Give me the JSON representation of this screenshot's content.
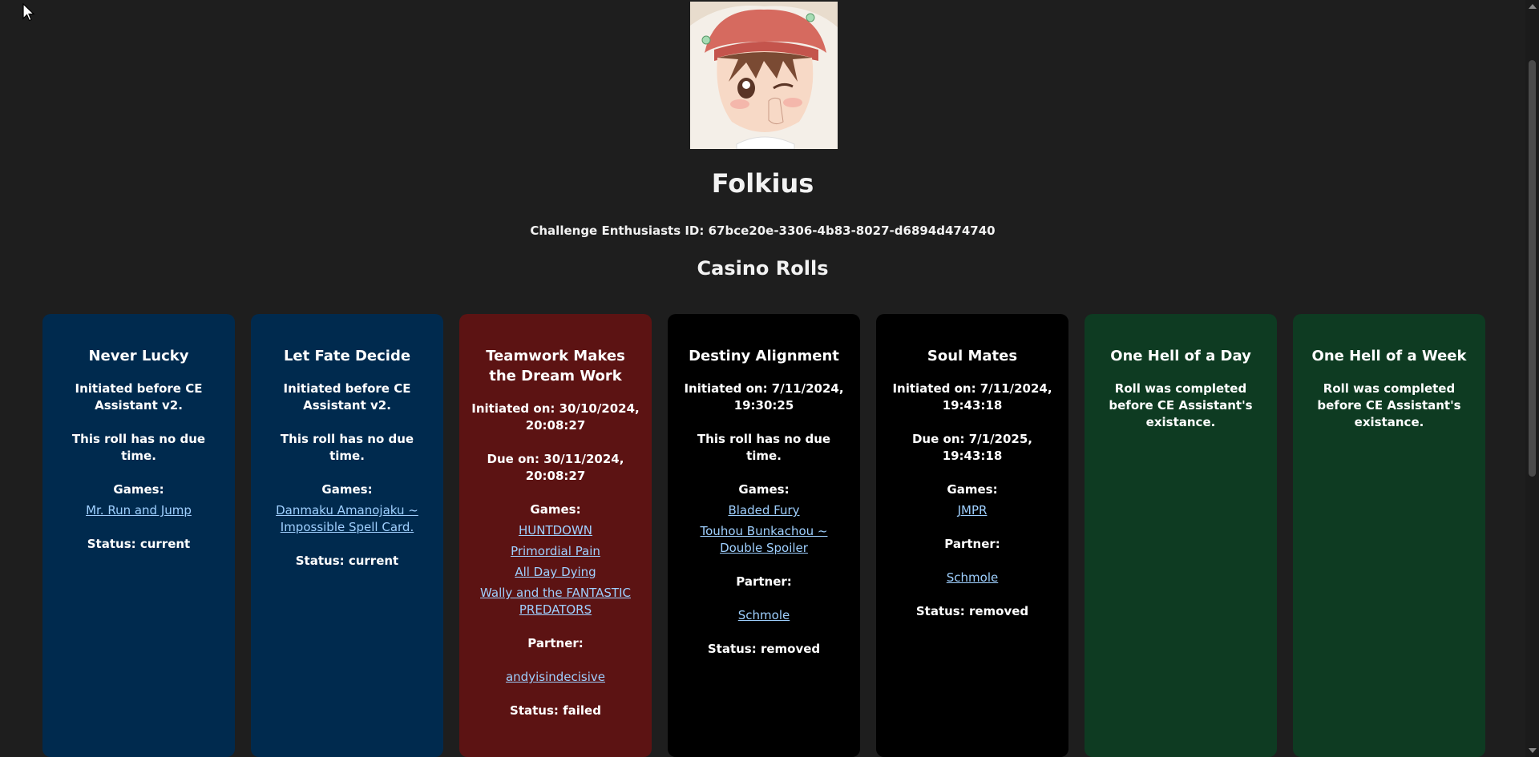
{
  "profile": {
    "username": "Folkius",
    "ce_id": "Challenge Enthusiasts ID: 67bce20e-3306-4b83-8027-d6894d474740"
  },
  "section": {
    "title": "Casino Rolls"
  },
  "labels": {
    "games": "Games:",
    "partner": "Partner:"
  },
  "cards": [
    {
      "title": "Never Lucky",
      "initiated": "Initiated before CE Assistant v2.",
      "due": "This roll has no due time.",
      "games": [
        "Mr. Run and Jump"
      ],
      "status": "Status: current",
      "color": "#002a4e"
    },
    {
      "title": "Let Fate Decide",
      "initiated": "Initiated before CE Assistant v2.",
      "due": "This roll has no due time.",
      "games": [
        "Danmaku Amanojaku ~ Impossible Spell Card."
      ],
      "status": "Status: current",
      "color": "#002a4e"
    },
    {
      "title": "Teamwork Makes the Dream Work",
      "initiated": "Initiated on: 30/10/2024, 20:08:27",
      "due": "Due on: 30/11/2024, 20:08:27",
      "games": [
        "HUNTDOWN",
        "Primordial Pain",
        "All Day Dying",
        "Wally and the FANTASTIC PREDATORS"
      ],
      "partner": "andyisindecisive",
      "status": "Status: failed",
      "color": "#5c1313"
    },
    {
      "title": "Destiny Alignment",
      "initiated": "Initiated on: 7/11/2024, 19:30:25",
      "due": "This roll has no due time.",
      "games": [
        "Bladed Fury",
        "Touhou Bunkachou ~ Double Spoiler"
      ],
      "partner": "Schmole",
      "status": "Status: removed",
      "color": "#000000"
    },
    {
      "title": "Soul Mates",
      "initiated": "Initiated on: 7/11/2024, 19:43:18",
      "due": "Due on: 7/1/2025, 19:43:18",
      "games": [
        "JMPR"
      ],
      "partner": "Schmole",
      "status": "Status: removed",
      "color": "#000000"
    },
    {
      "title": "One Hell of a Day",
      "note": "Roll was completed before CE Assistant's existance.",
      "color": "#0e3b22"
    },
    {
      "title": "One Hell of a Week",
      "note": "Roll was completed before CE Assistant's existance.",
      "color": "#0e3b22"
    }
  ]
}
